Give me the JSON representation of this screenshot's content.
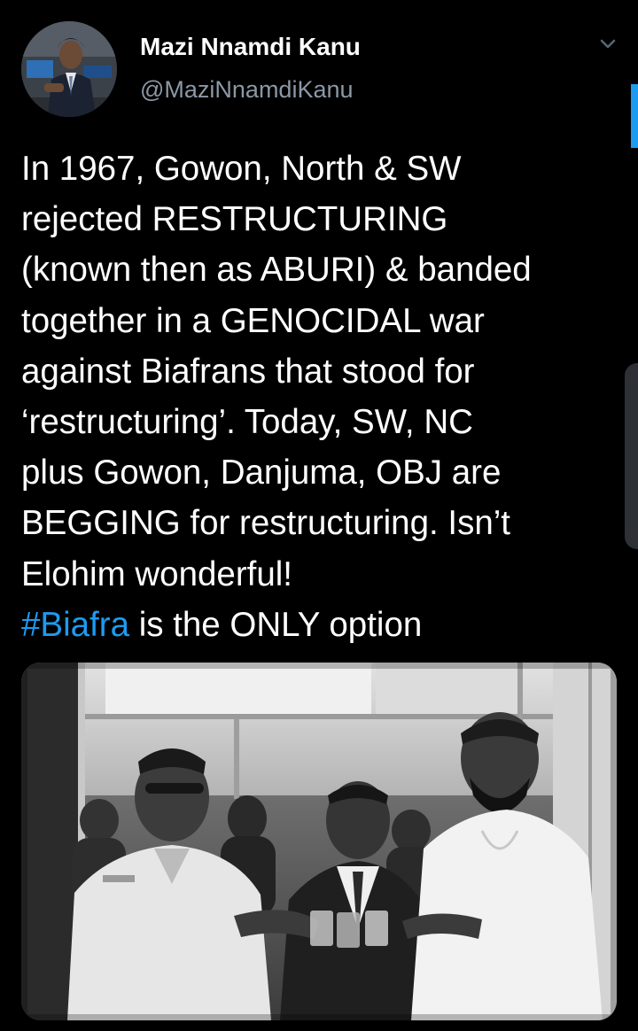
{
  "tweet": {
    "author": {
      "display_name": "Mazi Nnamdi Kanu",
      "handle": "@MaziNnamdiKanu",
      "avatar_icon": "profile-photo"
    },
    "menu_icon": "chevron-down-icon",
    "text_lines": [
      "In 1967, Gowon, North & SW",
      "rejected RESTRUCTURING",
      "(known then as ABURI) & banded",
      "together in a GENOCIDAL war",
      "against Biafrans that stood for",
      "‘restructuring’. Today, SW, NC",
      "plus Gowon, Danjuma, OBJ are",
      "BEGGING for restructuring. Isn’t",
      "Elohim wonderful!"
    ],
    "last_line": {
      "hashtag": "#Biafra",
      "rest": " is the ONLY option"
    },
    "media": {
      "type": "black-and-white photograph"
    }
  },
  "colors": {
    "background": "#000000",
    "text": "#ffffff",
    "secondary_text": "#8b98a5",
    "link": "#1d9bf0"
  }
}
